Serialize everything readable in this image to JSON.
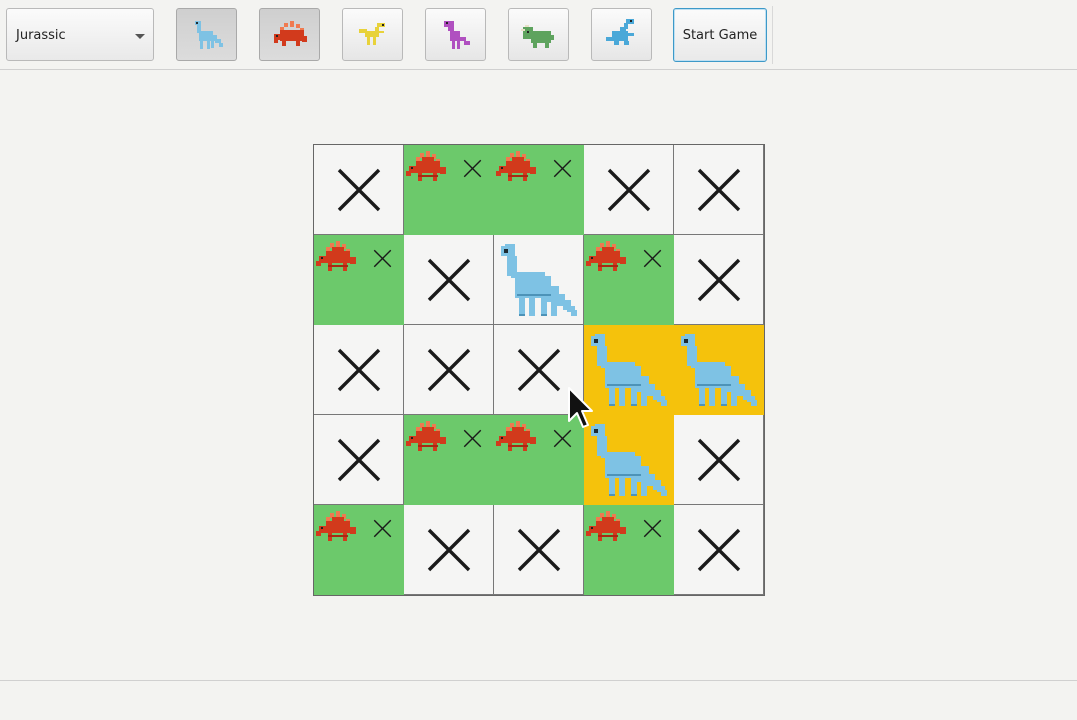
{
  "toolbar": {
    "era_select": {
      "value": "Jurassic"
    },
    "dino_buttons": [
      {
        "name": "Brontosaurus",
        "icon": "blue-brontosaurus-icon",
        "pressed": true
      },
      {
        "name": "Stegosaurus",
        "icon": "red-stegosaurus-icon",
        "pressed": true
      },
      {
        "name": "Raptor",
        "icon": "yellow-raptor-icon",
        "pressed": false
      },
      {
        "name": "T-Rex",
        "icon": "purple-trex-icon",
        "pressed": false
      },
      {
        "name": "Triceratops",
        "icon": "green-triceratops-icon",
        "pressed": false
      },
      {
        "name": "Plesiosaur",
        "icon": "blue-plesiosaur-icon",
        "pressed": false
      }
    ],
    "start_label": "Start Game"
  },
  "colors": {
    "green_cell": "#6cc96b",
    "yellow_cell": "#f5c20c",
    "empty_cell": "#f5f5f4",
    "brontosaurus": "#7ec2e4",
    "stegosaurus": "#d23a1c"
  },
  "board": {
    "rows": 5,
    "cols": 5,
    "cells": [
      [
        "x",
        "steg",
        "steg",
        "x",
        "x"
      ],
      [
        "steg",
        "x",
        "bronto",
        "steg",
        "x"
      ],
      [
        "x",
        "x",
        "x",
        "bronto-yellow",
        "bronto-yellow"
      ],
      [
        "x",
        "steg",
        "steg",
        "bronto-yellow",
        "x"
      ],
      [
        "steg",
        "x",
        "x",
        "steg",
        "x"
      ]
    ]
  }
}
